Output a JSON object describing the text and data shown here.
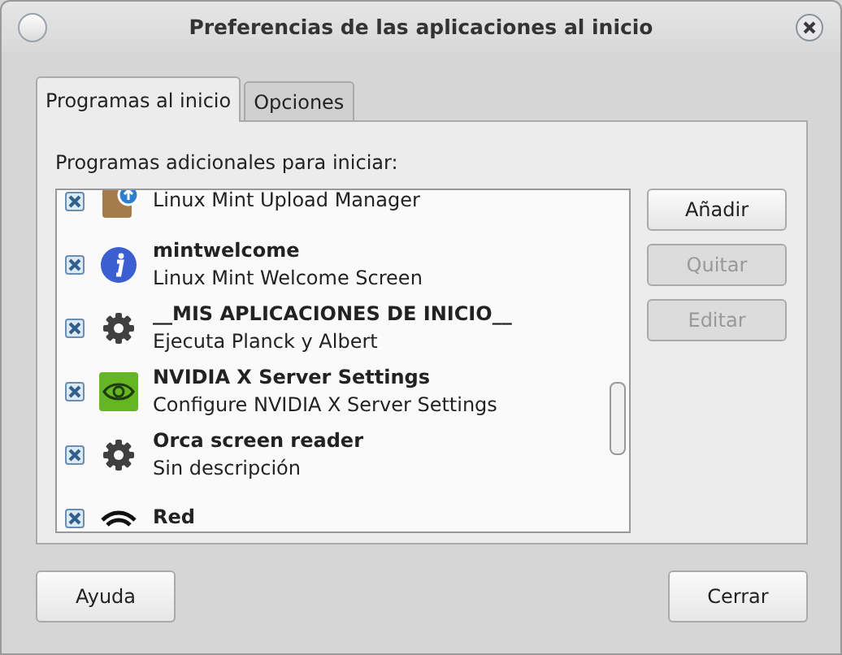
{
  "window": {
    "title": "Preferencias de las aplicaciones al inicio"
  },
  "tabs": [
    {
      "label": "Programas al inicio",
      "selected": true
    },
    {
      "label": "Opciones",
      "selected": false
    }
  ],
  "list_label": "Programas adicionales para iniciar:",
  "programs": [
    {
      "kind": "box",
      "description": "Linux Mint Upload Manager",
      "checked": true
    },
    {
      "kind": "info",
      "name": "mintwelcome",
      "description": "Linux Mint Welcome Screen",
      "checked": true
    },
    {
      "kind": "gear",
      "name": "__MIS APLICACIONES DE INICIO__",
      "description": "Ejecuta Planck y Albert",
      "checked": true
    },
    {
      "kind": "nvidia",
      "name": "NVIDIA X Server Settings",
      "description": "Configure NVIDIA X Server Settings",
      "checked": true
    },
    {
      "kind": "gear",
      "name": "Orca screen reader",
      "description": "Sin descripción",
      "checked": true
    },
    {
      "kind": "wifi",
      "name": "Red",
      "checked": true
    }
  ],
  "side_buttons": [
    {
      "label": "Añadir",
      "disabled": false
    },
    {
      "label": "Quitar",
      "disabled": true
    },
    {
      "label": "Editar",
      "disabled": true
    }
  ],
  "bottom_buttons": [
    "Ayuda",
    "Cerrar"
  ]
}
